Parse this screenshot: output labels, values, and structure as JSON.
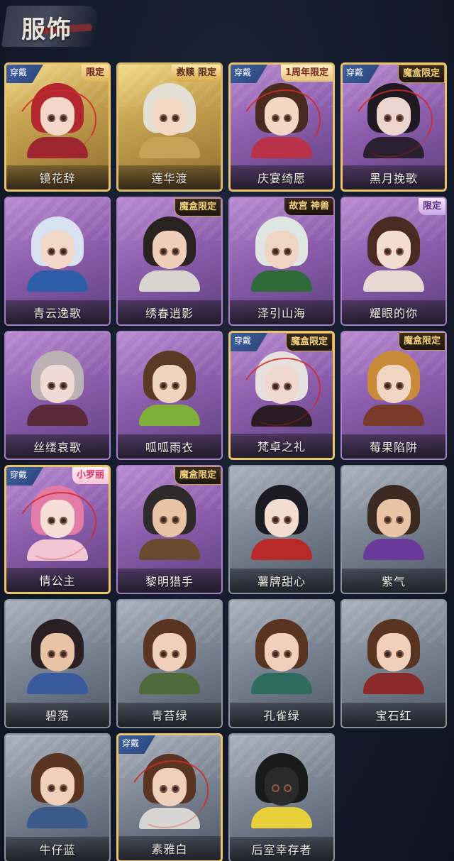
{
  "header": {
    "title": "服饰"
  },
  "labels": {
    "equipped": "穿戴"
  },
  "cards": [
    {
      "name": "镜花辞",
      "frame": "gold",
      "badge": "限定",
      "badge_style": "limited",
      "equipped": true,
      "hair": "#b3272f",
      "body": "#9e2630",
      "face": "#f3d7c8"
    },
    {
      "name": "莲华渡",
      "frame": "gold",
      "badge": "救赎 限定",
      "badge_style": "glory",
      "equipped": false,
      "hair": "#e4e0d6",
      "body": "#c9a25a",
      "face": "#f1d9c6"
    },
    {
      "name": "庆宴绮愿",
      "frame": "purple",
      "badge": "1周年限定",
      "badge_style": "anniv",
      "equipped": true,
      "hair": "#4a2a1e",
      "body": "#b8324a",
      "face": "#f3d6c3"
    },
    {
      "name": "黑月挽歌",
      "frame": "purple",
      "badge": "魔盒限定",
      "badge_style": "box",
      "equipped": true,
      "hair": "#1f1820",
      "body": "#2a1f2e",
      "face": "#ecd4cf"
    },
    {
      "name": "青云逸歌",
      "frame": "purple",
      "badge": "",
      "badge_style": "",
      "equipped": false,
      "hair": "#d8e2f0",
      "body": "#2d5fa8",
      "face": "#f2d8c8"
    },
    {
      "name": "绣春逍影",
      "frame": "purple",
      "badge": "魔盒限定",
      "badge_style": "box",
      "equipped": false,
      "hair": "#2a2220",
      "body": "#d8d4cf",
      "face": "#efcfb9"
    },
    {
      "name": "泽引山海",
      "frame": "purple",
      "badge": "故宫 神兽",
      "badge_style": "palace",
      "equipped": false,
      "hair": "#dfe6e2",
      "body": "#2f6a3a",
      "face": "#efd6c4"
    },
    {
      "name": "耀眼的你",
      "frame": "purple",
      "badge": "限定",
      "badge_style": "cornerstar",
      "equipped": false,
      "hair": "#4a2a22",
      "body": "#e7d8d2",
      "face": "#f3dcd0"
    },
    {
      "name": "丝缕哀歌",
      "frame": "purple",
      "badge": "",
      "badge_style": "",
      "equipped": false,
      "hair": "#bcb2b6",
      "body": "#5a2a3a",
      "face": "#f0dad6"
    },
    {
      "name": "呱呱雨衣",
      "frame": "purple",
      "badge": "",
      "badge_style": "",
      "equipped": false,
      "hair": "#5a3a26",
      "body": "#7fae3a",
      "face": "#f1d4bf"
    },
    {
      "name": "梵卓之礼",
      "frame": "purple",
      "badge": "魔盒限定",
      "badge_style": "box",
      "equipped": true,
      "hair": "#e6e1de",
      "body": "#2a1a22",
      "face": "#efd8cf"
    },
    {
      "name": "莓果陷阱",
      "frame": "purple",
      "badge": "魔盒限定",
      "badge_style": "box",
      "equipped": false,
      "hair": "#c98a3a",
      "body": "#7a3a2a",
      "face": "#f1d6c4"
    },
    {
      "name": "情公主",
      "frame": "purple",
      "badge": "小罗丽",
      "badge_style": "pink",
      "equipped": true,
      "hair": "#e47aa6",
      "body": "#f2c6d4",
      "face": "#f6dfd8"
    },
    {
      "name": "黎明猎手",
      "frame": "purple",
      "badge": "魔盒限定",
      "badge_style": "box",
      "equipped": false,
      "hair": "#2e2a2c",
      "body": "#6a4a2e",
      "face": "#e9c3a6"
    },
    {
      "name": "薯牌甜心",
      "frame": "grey",
      "badge": "",
      "badge_style": "",
      "equipped": false,
      "hair": "#1c1a22",
      "body": "#b82a2a",
      "face": "#f3dcd0"
    },
    {
      "name": "紫气",
      "frame": "grey",
      "badge": "",
      "badge_style": "",
      "equipped": false,
      "hair": "#3a2a22",
      "body": "#6a3a9a",
      "face": "#e9c3a6"
    },
    {
      "name": "碧落",
      "frame": "grey",
      "badge": "",
      "badge_style": "",
      "equipped": false,
      "hair": "#2a2024",
      "body": "#3a5a9e",
      "face": "#e9c3a6"
    },
    {
      "name": "青苔绿",
      "frame": "grey",
      "badge": "",
      "badge_style": "",
      "equipped": false,
      "hair": "#5a3422",
      "body": "#4e6a3a",
      "face": "#f0d0bc"
    },
    {
      "name": "孔雀绿",
      "frame": "grey",
      "badge": "",
      "badge_style": "",
      "equipped": false,
      "hair": "#5a3422",
      "body": "#2e6a5e",
      "face": "#f0d0bc"
    },
    {
      "name": "宝石红",
      "frame": "grey",
      "badge": "",
      "badge_style": "",
      "equipped": false,
      "hair": "#5a3422",
      "body": "#8a2a2a",
      "face": "#f0d0bc"
    },
    {
      "name": "牛仔蓝",
      "frame": "grey",
      "badge": "",
      "badge_style": "",
      "equipped": false,
      "hair": "#5a3422",
      "body": "#3a5a8a",
      "face": "#f0d0bc"
    },
    {
      "name": "素雅白",
      "frame": "grey",
      "badge": "",
      "badge_style": "",
      "equipped": true,
      "hair": "#5a3422",
      "body": "#d8d6d2",
      "face": "#f0d0bc"
    },
    {
      "name": "后室幸存者",
      "frame": "grey",
      "badge": "",
      "badge_style": "",
      "equipped": false,
      "hair": "#1a1a1a",
      "body": "#e8d03a",
      "face": "#2a2a2a"
    }
  ]
}
